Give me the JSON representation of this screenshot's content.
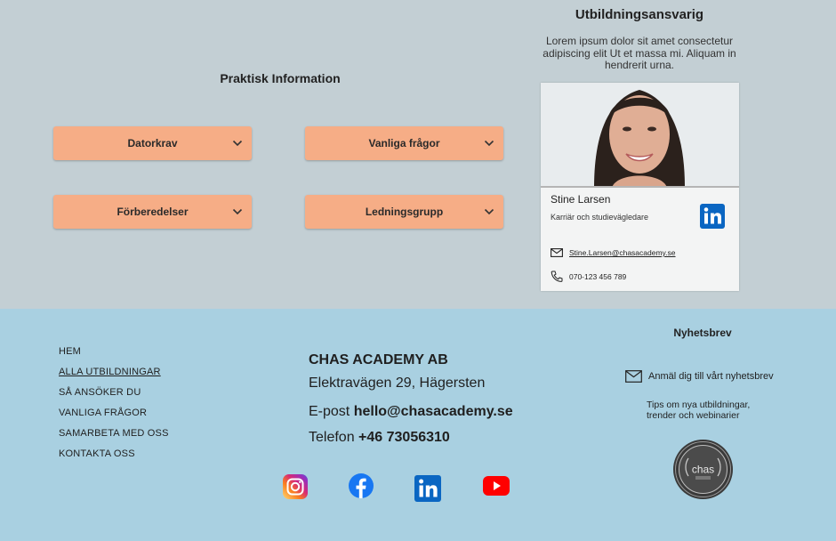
{
  "practical": {
    "title": "Praktisk Information",
    "accordions": [
      "Datorkrav",
      "Vanliga frågor",
      "Förberedelser",
      "Ledningsgrupp"
    ]
  },
  "responsible": {
    "title": "Utbildningsansvarig",
    "description": "Lorem ipsum dolor sit amet consectetur adipiscing elit Ut et massa mi. Aliquam in hendrerit urna.",
    "name": "Stine Larsen",
    "role": "Karriär och studievägledare",
    "email": "Stine.Larsen@chasacademy.se",
    "phone": "070-123 456  789"
  },
  "footer": {
    "nav": [
      "HEM",
      "ALLA UTBILDNINGAR",
      "SÅ ANSÖKER DU",
      "VANLIGA FRÅGOR",
      "SAMARBETA MED OSS",
      "KONTAKTA OSS"
    ],
    "company": {
      "name": "CHAS ACADEMY AB",
      "address": "Elektravägen 29, Hägersten",
      "email_label": "E-post",
      "email": "hello@chasacademy.se",
      "phone_label": "Telefon",
      "phone": "+46 73056310"
    },
    "newsletter": {
      "title": "Nyhetsbrev",
      "signup": "Anmäl dig till vårt nyhetsbrev",
      "tips": "Tips om nya utbildningar, trender och webinarier"
    },
    "badge_text": "chas"
  },
  "colors": {
    "top_bg": "#c3cfd4",
    "footer_bg": "#a9d0e1",
    "accordion": "#f6ad86",
    "linkedin": "#0a66c2",
    "facebook": "#1877f2",
    "youtube": "#ff0000"
  },
  "icons": [
    "chevron-down-icon",
    "mail-icon",
    "phone-icon",
    "linkedin-icon",
    "instagram-icon",
    "facebook-icon",
    "youtube-icon"
  ]
}
